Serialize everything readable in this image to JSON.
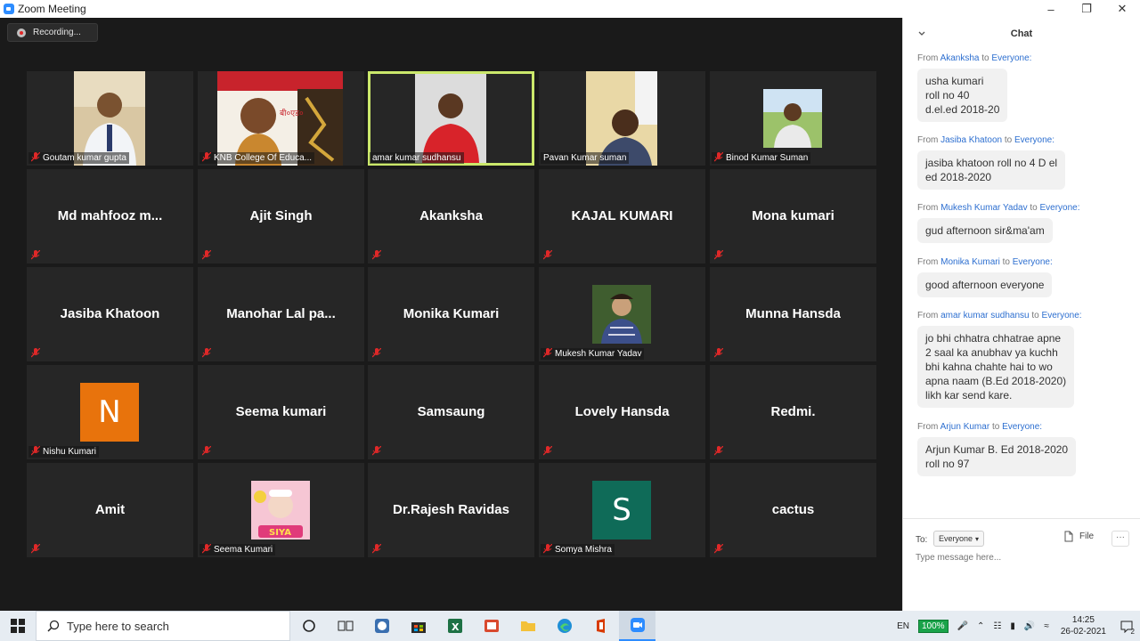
{
  "window": {
    "title": "Zoom Meeting"
  },
  "recording": {
    "label": "Recording..."
  },
  "tiles": [
    {
      "name": "Goutam kumar gupta",
      "type": "photo"
    },
    {
      "name": "KNB College Of Educa...",
      "type": "photo"
    },
    {
      "name": "amar kumar sudhansu",
      "type": "photo",
      "active": true
    },
    {
      "name": "Pavan Kumar suman",
      "type": "photo"
    },
    {
      "name": "Binod Kumar Suman",
      "type": "photo"
    },
    {
      "name": "Md  mahfooz  m...",
      "type": "name"
    },
    {
      "name": "Ajit Singh",
      "type": "name"
    },
    {
      "name": "Akanksha",
      "type": "name"
    },
    {
      "name": "KAJAL KUMARI",
      "type": "name"
    },
    {
      "name": "Mona kumari",
      "type": "name"
    },
    {
      "name": "Jasiba Khatoon",
      "type": "name"
    },
    {
      "name": "Manohar  Lal  pa...",
      "type": "name"
    },
    {
      "name": "Monika Kumari",
      "type": "name"
    },
    {
      "name": "Mukesh Kumar Yadav",
      "type": "photo"
    },
    {
      "name": "Munna Hansda",
      "type": "name"
    },
    {
      "name": "Nishu Kumari",
      "type": "letter",
      "letter": "N"
    },
    {
      "name": "Seema kumari",
      "type": "name"
    },
    {
      "name": "Samsaung",
      "type": "name"
    },
    {
      "name": "Lovely Hansda",
      "type": "name"
    },
    {
      "name": "Redmi.",
      "type": "name"
    },
    {
      "name": "Amit",
      "type": "name"
    },
    {
      "name": "Seema Kumari",
      "type": "photo"
    },
    {
      "name": "Dr.Rajesh Ravidas",
      "type": "name"
    },
    {
      "name": "Somya Mishra",
      "type": "letter",
      "letter": "S"
    },
    {
      "name": "cactus",
      "type": "name"
    }
  ],
  "chat": {
    "title": "Chat",
    "from_word": "From",
    "to_word": "to",
    "everyone": "Everyone:",
    "messages": [
      {
        "sender": "Akanksha",
        "text": "usha kumari\nroll no 40\nd.el.ed 2018-20"
      },
      {
        "sender": "Jasiba Khatoon",
        "text": "jasiba khatoon roll no 4 D el\ned 2018-2020"
      },
      {
        "sender": "Mukesh Kumar Yadav",
        "text": "gud afternoon sir&ma'am"
      },
      {
        "sender": "Monika Kumari",
        "text": "good afternoon everyone"
      },
      {
        "sender": "amar kumar sudhansu",
        "text": "jo bhi chhatra chhatrae apne\n2 saal ka anubhav ya kuchh\nbhi kahna chahte hai to wo\napna naam  (B.Ed 2018-2020)\nlikh kar send kare."
      },
      {
        "sender": "Arjun Kumar",
        "text": "Arjun Kumar B. Ed 2018-2020\nroll no 97"
      }
    ],
    "to_label": "To:",
    "recipient": "Everyone",
    "file_label": "File",
    "more_label": "···",
    "input_placeholder": "Type message here..."
  },
  "taskbar": {
    "search_placeholder": "Type here to search",
    "lang": "EN",
    "battery": "100%",
    "time": "14:25",
    "date": "26-02-2021",
    "notif_count": "2"
  },
  "colors": {
    "active_border": "#cbe86b",
    "letter_N": "#e8730c",
    "letter_S": "#0f6b58",
    "link_blue": "#2d6fd0"
  }
}
